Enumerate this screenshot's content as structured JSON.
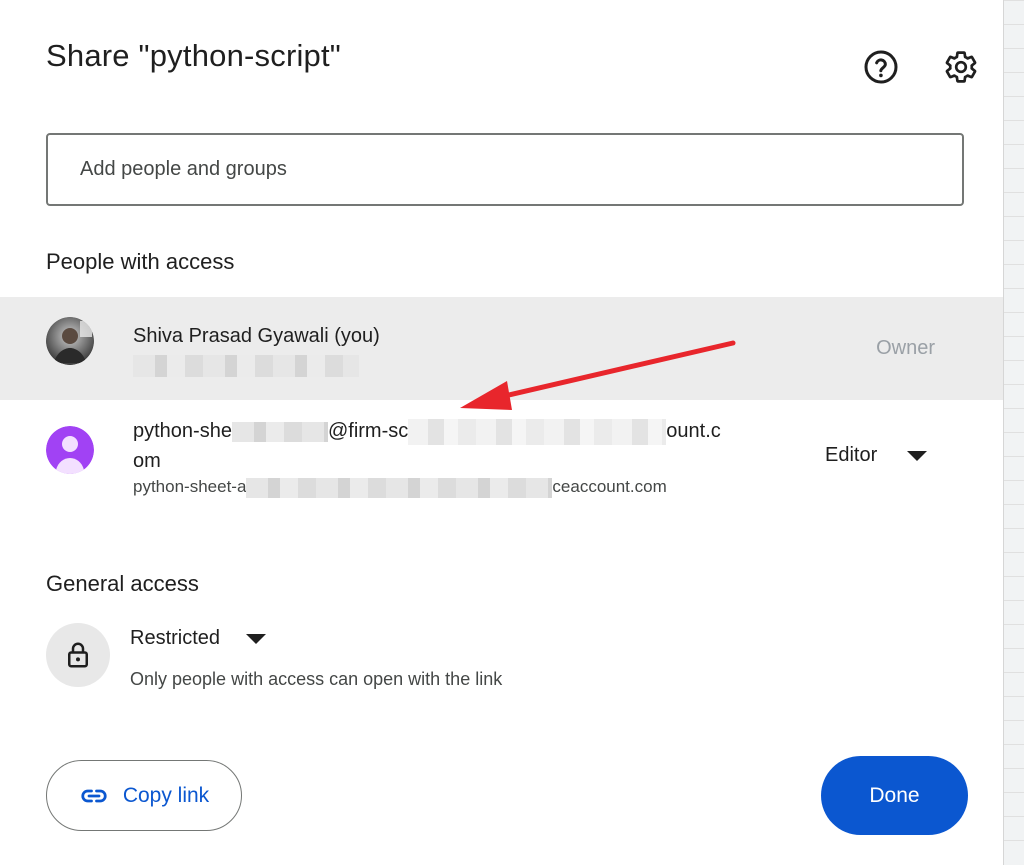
{
  "dialog": {
    "title": "Share \"python-script\"",
    "help_icon": "help-circle-icon",
    "settings_icon": "gear-icon"
  },
  "search": {
    "placeholder": "Add people and groups"
  },
  "people_section": {
    "title": "People with access",
    "people": [
      {
        "name": "Shiva Prasad Gyawali (you)",
        "email": "",
        "role": "Owner",
        "avatar": "profile-photo"
      },
      {
        "name_part1": "python-she",
        "name_part2": "@firm-sc",
        "name_part3": "ount.c",
        "name_part4": "om",
        "email_start": "python-sheet-a",
        "email_end": "ceaccount.com",
        "role": "Editor",
        "avatar": "default-person-avatar"
      }
    ]
  },
  "general_access": {
    "title": "General access",
    "level": "Restricted",
    "description": "Only people with access can open with the link",
    "icon": "lock-icon"
  },
  "actions": {
    "copy_link_label": "Copy link",
    "done_label": "Done"
  },
  "colors": {
    "accent": "#0b57d0",
    "annotation_arrow": "#e8262c",
    "owner_row_bg": "#ececec",
    "editor_avatar": "#a142f4"
  }
}
